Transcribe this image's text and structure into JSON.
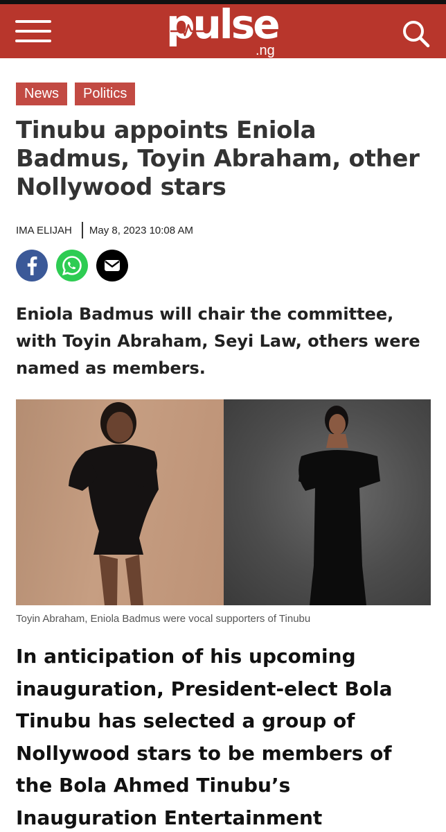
{
  "header": {
    "logo_word": "pulse",
    "logo_tld": ".ng",
    "background": "#b8362c",
    "menu_icon": "hamburger-menu-icon",
    "search_icon": "search-icon"
  },
  "tags": [
    {
      "label": "News"
    },
    {
      "label": "Politics"
    }
  ],
  "article": {
    "title": "Tinubu appoints Eniola Badmus, Toyin Abraham, other Nollywood stars",
    "author": "IMA ELIJAH",
    "date": "May 8, 2023 10:08 AM",
    "share": [
      {
        "icon": "facebook-icon",
        "color": "#3b5998"
      },
      {
        "icon": "whatsapp-icon",
        "color": "#2ecc53"
      },
      {
        "icon": "email-icon",
        "color": "#000000"
      }
    ],
    "lede": "Eniola Badmus will chair the committee, with Toyin Abraham, Seyi Law, others were named as members.",
    "image_caption": "Toyin Abraham, Eniola Badmus were vocal supporters of Tinubu",
    "body": "In anticipation of his upcoming inauguration, President-elect Bola Tinubu has selected a group of Nollywood stars to be members of the Bola Ahmed Tinubu’s Inauguration Entertainment Committee."
  }
}
